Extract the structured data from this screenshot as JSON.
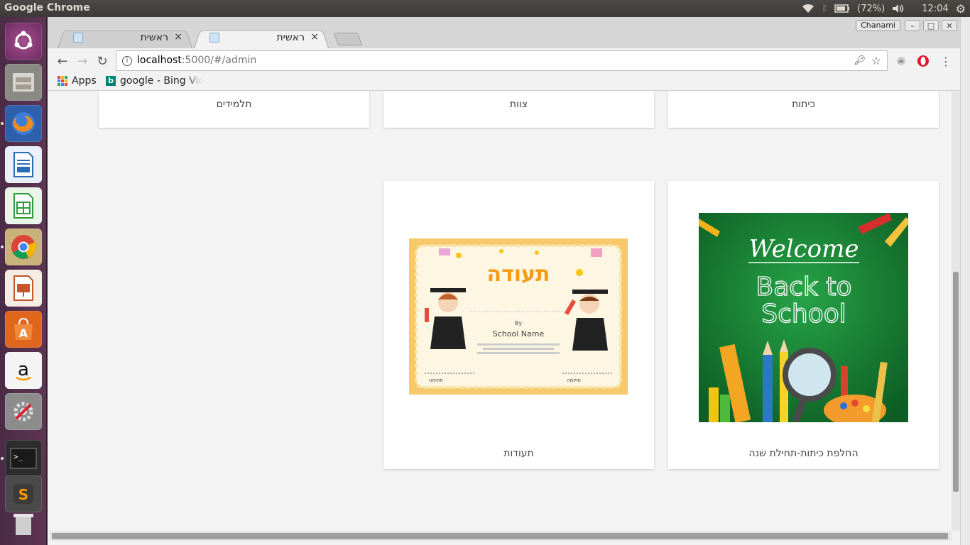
{
  "panel": {
    "app_title": "Google Chrome",
    "battery_text": "(72%)",
    "clock": "12:04"
  },
  "launcher": {
    "items": [
      "ubuntu-dash",
      "files",
      "firefox",
      "libreoffice-writer",
      "libreoffice-calc",
      "chrome",
      "libreoffice-impress",
      "software-center",
      "amazon",
      "system-settings",
      "terminal",
      "sublime-text",
      "trash"
    ]
  },
  "window": {
    "profile_name": "Chanami",
    "tabs": [
      {
        "label": "ראשית",
        "active": false
      },
      {
        "label": "ראשית",
        "active": true
      }
    ],
    "tab_close_glyph": "×"
  },
  "toolbar": {
    "url_host": "localhost",
    "url_path": ":5000/#/admin"
  },
  "bookmarks": {
    "apps_label": "Apps",
    "items": [
      "google - Bing Vid"
    ]
  },
  "page": {
    "top_cards": [
      "תלמידים",
      "צוות",
      "כיתות"
    ],
    "image_cards": [
      {
        "caption": "תעודות",
        "image": {
          "title": "תעודה",
          "by": "By",
          "school": "School Name",
          "signature_label": "חתימה"
        }
      },
      {
        "caption": "החלפת כיתות-תחילת שנה",
        "image": {
          "line1": "Welcome",
          "line2": "Back to",
          "line3": "School"
        }
      }
    ]
  },
  "colors": {
    "panel_bg": "#3c3b37",
    "launcher_bg": "#5d3654",
    "board_green": "#1f8a3a",
    "cert_border": "#f7c96b",
    "cert_title": "#f39c12"
  }
}
